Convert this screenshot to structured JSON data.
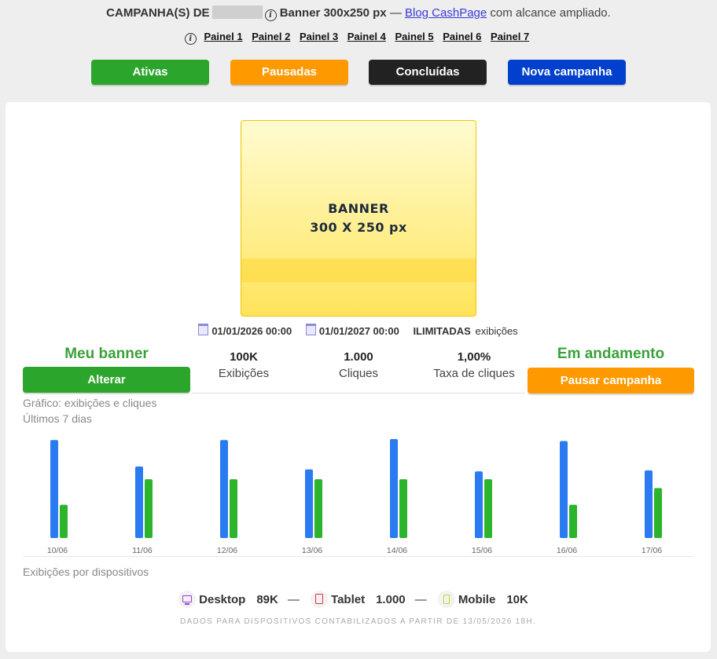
{
  "header": {
    "prefix": "CAMPANHA(S) DE",
    "banner": "Banner 300x250 px",
    "dash": "—",
    "link": "Blog CashPage",
    "suffix": "com alcance ampliado."
  },
  "panels": [
    "Painel 1",
    "Painel 2",
    "Painel 3",
    "Painel 4",
    "Painel 5",
    "Painel 6",
    "Painel 7"
  ],
  "buttons": {
    "active": "Ativas",
    "paused": "Pausadas",
    "done": "Concluídas",
    "new": "Nova campanha"
  },
  "colors": {
    "green": "#2ca52c",
    "orange": "#ff9900",
    "black": "#222222",
    "blue": "#0040cc",
    "bar_blue": "#2a7af2",
    "bar_green": "#2cb52c"
  },
  "banner": {
    "line1": "BANNER",
    "line2": "300 X 250 px"
  },
  "dates": {
    "start": "01/01/2026 00:00",
    "end": "01/01/2027 00:00",
    "limit": "ILIMITADAS",
    "limit_suffix": "exibições"
  },
  "left": {
    "title": "Meu banner",
    "button": "Alterar"
  },
  "right": {
    "title": "Em andamento",
    "button": "Pausar campanha"
  },
  "stats": [
    {
      "value": "100K",
      "label": "Exibições"
    },
    {
      "value": "1.000",
      "label": "Cliques"
    },
    {
      "value": "1,00%",
      "label": "Taxa de cliques"
    }
  ],
  "chart_caption": {
    "line1": "Gráfico: exibições e cliques",
    "line2": "Últimos 7 dias"
  },
  "chart_data": {
    "type": "bar",
    "categories": [
      "10/06",
      "11/06",
      "12/06",
      "13/06",
      "14/06",
      "15/06",
      "16/06",
      "17/06"
    ],
    "series": [
      {
        "values": [
          100,
          73,
          100,
          70,
          101,
          68,
          99,
          69
        ]
      },
      {
        "values": [
          34,
          60,
          60,
          60,
          60,
          60,
          34,
          51
        ]
      }
    ],
    "ylim": [
      0,
      101
    ]
  },
  "devices_caption": "Exibições por dispositivos",
  "devices": [
    {
      "icon": "desktop-icon",
      "name": "Desktop",
      "value": "89K"
    },
    {
      "icon": "tablet-icon",
      "name": "Tablet",
      "value": "1.000"
    },
    {
      "icon": "mobile-icon",
      "name": "Mobile",
      "value": "10K"
    }
  ],
  "devices_sep": "—",
  "footnote": "DADOS PARA DISPOSITIVOS CONTABILIZADOS A PARTIR DE 13/05/2026 18H."
}
